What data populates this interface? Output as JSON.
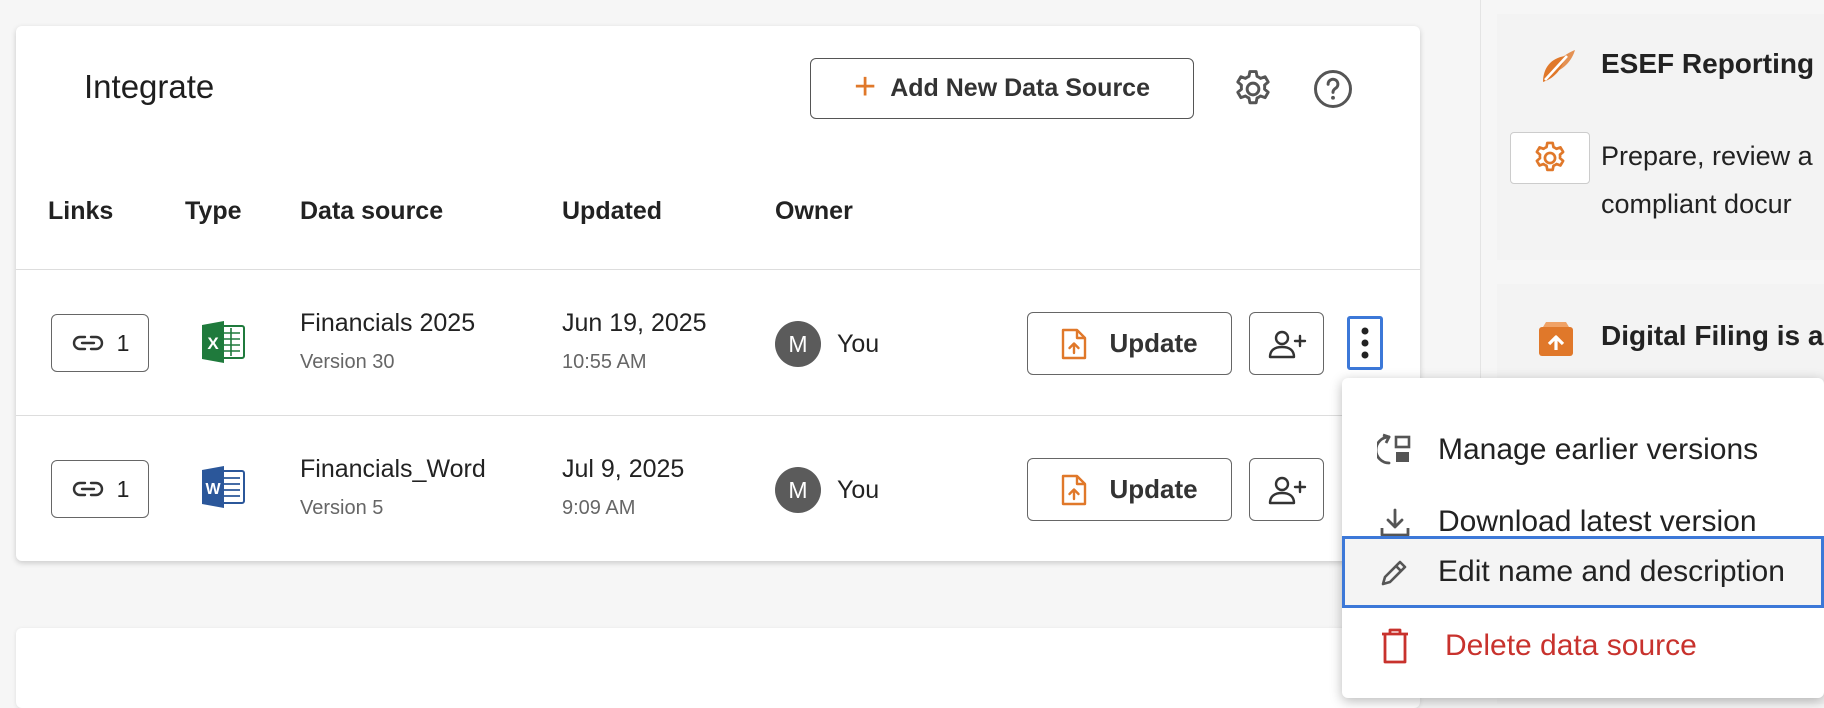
{
  "integrate": {
    "title": "Integrate",
    "add_button_label": "Add New Data Source",
    "columns": [
      "Links",
      "Type",
      "Data source",
      "Updated",
      "Owner"
    ],
    "rows": [
      {
        "links": "1",
        "type_icon": "excel-icon",
        "name": "Financials 2025",
        "version": "Version 30",
        "date": "Jun 19, 2025",
        "time": "10:55 AM",
        "owner_initial": "M",
        "owner_name": "You",
        "update_label": "Update"
      },
      {
        "links": "1",
        "type_icon": "word-icon",
        "name": "Financials_Word",
        "version": "Version 5",
        "date": "Jul 9, 2025",
        "time": "9:09 AM",
        "owner_initial": "M",
        "owner_name": "You",
        "update_label": "Update"
      }
    ]
  },
  "context_menu": {
    "items": [
      {
        "label": "Manage earlier versions",
        "icon": "versions-icon"
      },
      {
        "label": "Download latest version",
        "icon": "download-icon"
      },
      {
        "label": "Edit name and description",
        "icon": "pencil-icon"
      },
      {
        "label": "Delete data source",
        "icon": "trash-icon"
      }
    ]
  },
  "side_panel": {
    "esef": {
      "title": "ESEF Reporting",
      "text_line1": "Prepare, review a",
      "text_line2": "compliant docur"
    },
    "digital_filing": {
      "title": "Digital Filing is a"
    }
  },
  "colors": {
    "accent": "#e0782a",
    "focus": "#3c78d8",
    "danger": "#c8322d",
    "excel": "#1f7a3c",
    "word": "#2b579a"
  }
}
